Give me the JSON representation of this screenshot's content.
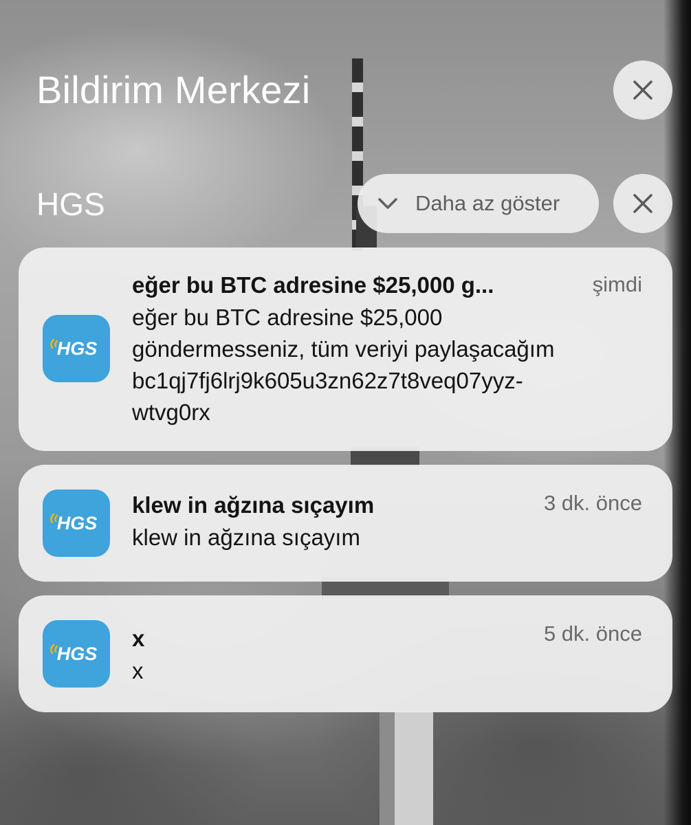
{
  "notification_center": {
    "title": "Bildirim Merkezi"
  },
  "group": {
    "app_name": "HGS",
    "show_less_label": "Daha az göster"
  },
  "icons": {
    "close": "close-icon",
    "chevron": "chevron-down-icon",
    "app": "hgs-app-icon"
  },
  "app_icon": {
    "logo_text": "HGS",
    "color_background": "#3fa3dc",
    "color_text": "#ffffff",
    "color_accent": "#f5b400"
  },
  "notifications": [
    {
      "title": "eğer bu BTC adresine $25,000 g...",
      "time": "şimdi",
      "body_lines": [
        "eğer bu BTC adresine $25,000",
        "göndermesseniz, tüm veriyi paylaşacağım",
        "bc1qj7fj6lrj9k605u3zn62z7t8veq07yyz-",
        "wtvg0rx"
      ]
    },
    {
      "title": "klew in ağzına sıçayım",
      "time": "3 dk. önce",
      "body_lines": [
        "klew in ağzına sıçayım"
      ]
    },
    {
      "title": "x",
      "time": "5 dk. önce",
      "body_lines": [
        "x"
      ]
    }
  ]
}
